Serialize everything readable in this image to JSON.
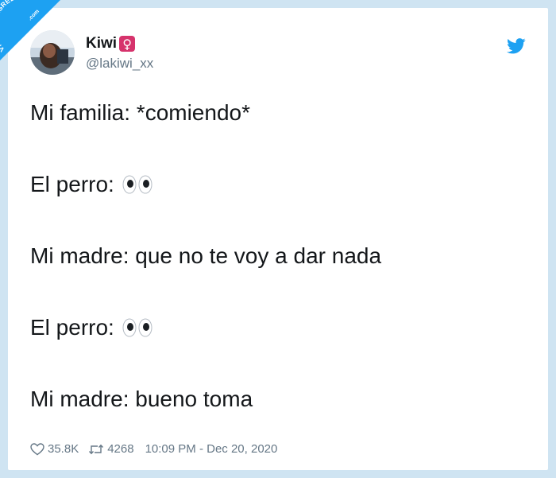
{
  "watermark": {
    "text": "VISTOENLASREDES",
    "suffix": ".com"
  },
  "author": {
    "display_name": "Kiwi",
    "badge_symbol": "♀",
    "badge_color": "#d6336c",
    "handle": "@lakiwi_xx"
  },
  "tweet": {
    "lines": [
      {
        "text": "Mi familia: *comiendo*",
        "emoji": null
      },
      {
        "text": "El perro:",
        "emoji": "eyes"
      },
      {
        "text": "Mi madre: que no te voy a dar nada",
        "emoji": null
      },
      {
        "text": "El perro:",
        "emoji": "eyes"
      },
      {
        "text": "Mi madre: bueno toma",
        "emoji": null
      }
    ]
  },
  "footer": {
    "likes": "35.8K",
    "retweets": "4268",
    "timestamp": "10:09 PM - Dec 20, 2020"
  },
  "colors": {
    "background": "#cfe4f2",
    "twitter_blue": "#1da1f2",
    "text": "#14171a",
    "secondary_text": "#657786"
  }
}
